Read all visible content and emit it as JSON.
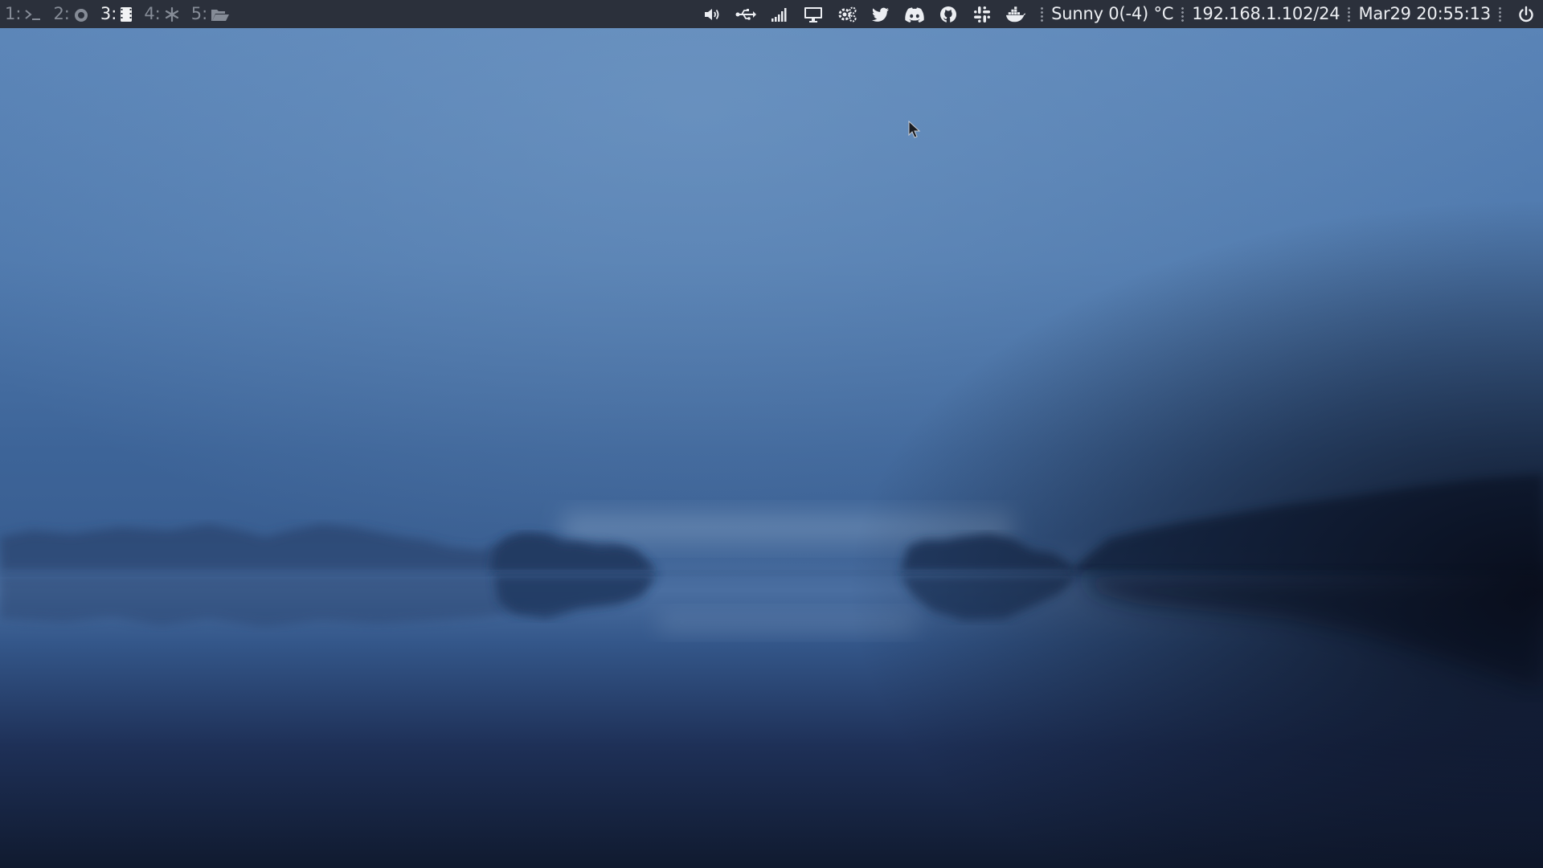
{
  "workspaces": [
    {
      "label": "1:",
      "icon": "terminal-icon",
      "active": false
    },
    {
      "label": "2:",
      "icon": "firefox-icon",
      "active": false
    },
    {
      "label": "3:",
      "icon": "film-icon",
      "active": true
    },
    {
      "label": "4:",
      "icon": "snowflake-icon",
      "active": false
    },
    {
      "label": "5:",
      "icon": "folder-open-icon",
      "active": false
    }
  ],
  "tray": {
    "icons": [
      "volume-icon",
      "usb-icon",
      "signal-icon",
      "monitor-icon",
      "settings-icon",
      "twitter-icon",
      "discord-icon",
      "github-icon",
      "slack-icon",
      "docker-icon"
    ],
    "weather": "Sunny 0(-4) °C",
    "ip_address": "192.168.1.102/24",
    "datetime": "Mar29 20:55:13",
    "power_icon": "power-icon"
  },
  "colors": {
    "bar_background": "#2b303b",
    "active_workspace": "#f2f3f5",
    "inactive_workspace": "#858b96",
    "wallpaper_sky_top": "#5a84b6",
    "wallpaper_water_bottom": "#111a30"
  }
}
